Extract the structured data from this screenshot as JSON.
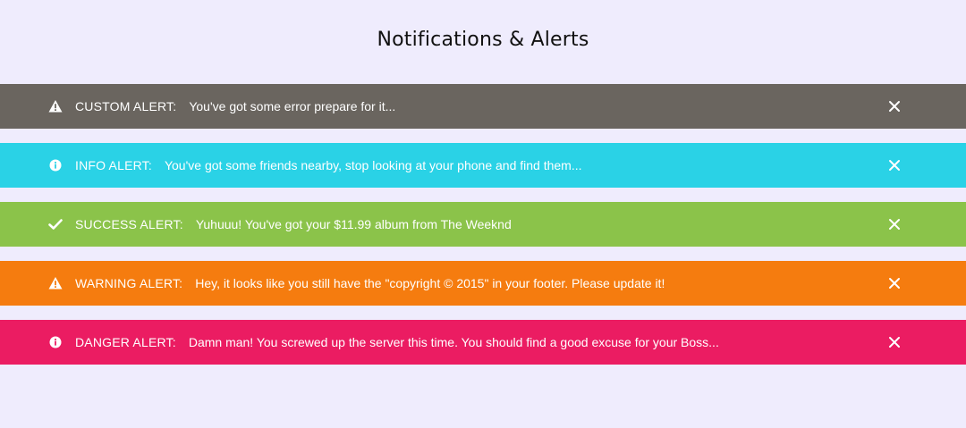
{
  "page": {
    "title": "Notifications & Alerts"
  },
  "alerts": [
    {
      "label": "CUSTOM ALERT:",
      "message": "You've got some error prepare for it...",
      "icon": "warning-icon",
      "color": "#6a655f"
    },
    {
      "label": "INFO ALERT:",
      "message": "You've got some friends nearby, stop looking at your phone and find them...",
      "icon": "info-icon",
      "color": "#2ad2e6"
    },
    {
      "label": "SUCCESS ALERT:",
      "message": "Yuhuuu! You've got your $11.99 album from The Weeknd",
      "icon": "check-icon",
      "color": "#8bc34a"
    },
    {
      "label": "WARNING ALERT:",
      "message": "Hey, it looks like you still have the \"copyright © 2015\" in your footer. Please update it!",
      "icon": "warning-icon",
      "color": "#f57c0f"
    },
    {
      "label": "DANGER ALERT:",
      "message": "Damn man! You screwed up the server this time. You should find a good excuse for your Boss...",
      "icon": "info-icon",
      "color": "#eb1c62"
    }
  ],
  "close_icon": "close-icon"
}
